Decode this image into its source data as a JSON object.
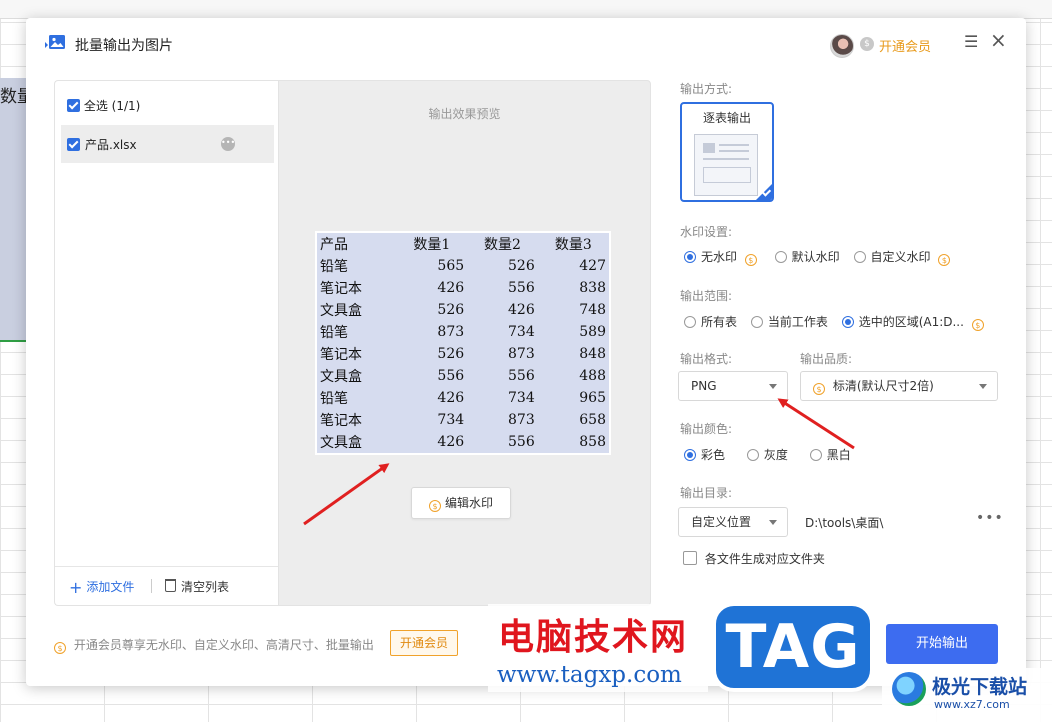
{
  "sheet": {
    "cell_text": "数量"
  },
  "dialog": {
    "title": "批量输出为图片",
    "vip_link": "开通会员",
    "menu_glyph": "☰",
    "close_glyph": "×",
    "coin_glyph": "$"
  },
  "file_list": {
    "select_all": "全选 (1/1)",
    "files": [
      {
        "name": "产品.xlsx",
        "checked": true
      }
    ],
    "more_glyph": "•••",
    "add_file": "添加文件",
    "clear_list": "清空列表"
  },
  "preview": {
    "label": "输出效果预览",
    "headers": [
      "产品",
      "数量1",
      "数量2",
      "数量3"
    ],
    "rows": [
      [
        "铅笔",
        "565",
        "526",
        "427"
      ],
      [
        "笔记本",
        "426",
        "556",
        "838"
      ],
      [
        "文具盒",
        "526",
        "426",
        "748"
      ],
      [
        "铅笔",
        "873",
        "734",
        "589"
      ],
      [
        "笔记本",
        "526",
        "873",
        "848"
      ],
      [
        "文具盒",
        "556",
        "556",
        "488"
      ],
      [
        "铅笔",
        "426",
        "734",
        "965"
      ],
      [
        "笔记本",
        "734",
        "873",
        "658"
      ],
      [
        "文具盒",
        "426",
        "556",
        "858"
      ]
    ],
    "edit_watermark": "编辑水印"
  },
  "settings": {
    "output_mode_label": "输出方式:",
    "output_mode_option": "逐表输出",
    "watermark_label": "水印设置:",
    "watermark_options": [
      "无水印",
      "默认水印",
      "自定义水印"
    ],
    "watermark_selected": "无水印",
    "range_label": "输出范围:",
    "range_options": [
      "所有表",
      "当前工作表",
      "选中的区域(A1:D..."
    ],
    "range_selected": "选中的区域(A1:D...",
    "format_label": "输出格式:",
    "format_value": "PNG",
    "quality_label": "输出品质:",
    "quality_value": "标清(默认尺寸2倍)",
    "color_label": "输出颜色:",
    "color_options": [
      "彩色",
      "灰度",
      "黑白"
    ],
    "color_selected": "彩色",
    "dir_label": "输出目录:",
    "dir_mode": "自定义位置",
    "dir_path": "D:\\tools\\桌面\\",
    "dir_more": "•••",
    "subfolder_option": "各文件生成对应文件夹"
  },
  "footer": {
    "promo_text": "开通会员尊享无水印、自定义水印、高清尺寸、批量输出",
    "promo_button": "开通会员",
    "start_button": "开始输出"
  },
  "watermark_overlay": {
    "brand_cn": "电脑技术网",
    "brand_url": "www.tagxp.com",
    "tag": "TAG",
    "site_cn": "极光下载站",
    "site_url": "www.xz7.com"
  },
  "colors": {
    "accent": "#2f6fe0",
    "vip_orange": "#e89a1c",
    "start_button": "#3d6cf0",
    "preview_fill": "#d6dcef",
    "arrow_red": "#e02020"
  }
}
